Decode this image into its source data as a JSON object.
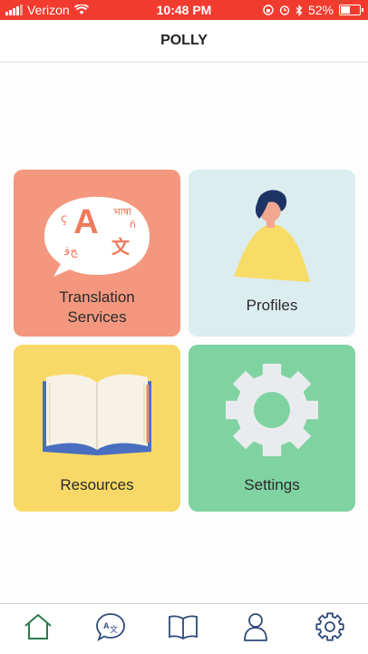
{
  "status_bar": {
    "carrier": "Verizon",
    "time": "10:48 PM",
    "battery": "52%",
    "battery_level": 0.52
  },
  "header": {
    "title": "POLLY"
  },
  "tiles": [
    {
      "label_line1": "Translation",
      "label_line2": "Services",
      "color": "#f3987e",
      "icon": "translation-bubble-icon"
    },
    {
      "label": "Profiles",
      "color": "#dcedf0",
      "icon": "person-icon"
    },
    {
      "label": "Resources",
      "color": "#f8d967",
      "icon": "open-book-icon"
    },
    {
      "label": "Settings",
      "color": "#7fd3a0",
      "icon": "gear-icon"
    }
  ],
  "translation_glyphs": {
    "big": "A",
    "hindi": "भाषा",
    "han": "文"
  },
  "tab_bar": {
    "accent": "#2b7a4b",
    "icon_color": "#2e4a7a",
    "tabs": [
      {
        "icon": "home-icon",
        "selected": true
      },
      {
        "icon": "translate-chat-icon",
        "selected": false
      },
      {
        "icon": "book-icon",
        "selected": false
      },
      {
        "icon": "person-icon",
        "selected": false
      },
      {
        "icon": "gear-icon",
        "selected": false
      }
    ]
  }
}
